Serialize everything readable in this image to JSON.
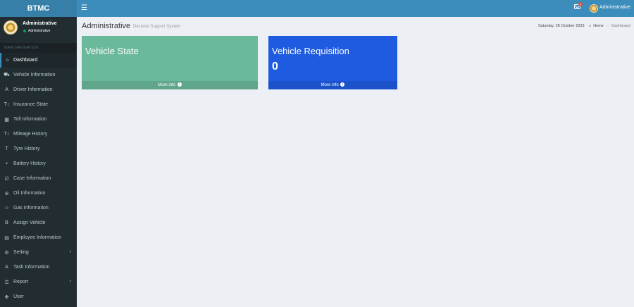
{
  "app": {
    "logo": "BTMC"
  },
  "topbar": {
    "mail_count": "0",
    "user_name": "Administrative"
  },
  "sidebar": {
    "user_name": "Administrative",
    "user_status": "Administrative",
    "nav_header": "MAIN NAVIGATION",
    "items": [
      {
        "label": "Dashboard",
        "icon": "home-icon",
        "glyph": "⌂"
      },
      {
        "label": "Vehicle Information",
        "icon": "car-icon",
        "glyph": "⛟"
      },
      {
        "label": "Driver Information",
        "icon": "driver-icon",
        "glyph": "A"
      },
      {
        "label": "Insurance State",
        "icon": "text-height-icon",
        "glyph": "T↕"
      },
      {
        "label": "Toll Information",
        "icon": "th-icon",
        "glyph": "▦"
      },
      {
        "label": "Mileage History",
        "icon": "text-height-icon",
        "glyph": "T↕"
      },
      {
        "label": "Tyre History",
        "icon": "text-width-icon",
        "glyph": "T"
      },
      {
        "label": "Battery History",
        "icon": "th-large-icon",
        "glyph": "▪"
      },
      {
        "label": "Case Information",
        "icon": "check-square-icon",
        "glyph": "☑"
      },
      {
        "label": "Oil Information",
        "icon": "life-ring-icon",
        "glyph": "⊛"
      },
      {
        "label": "Gas Information",
        "icon": "smile-icon",
        "glyph": "☺"
      },
      {
        "label": "Assign Vehicle",
        "icon": "bold-icon",
        "glyph": "B"
      },
      {
        "label": "Employee Information",
        "icon": "table-icon",
        "glyph": "▤"
      },
      {
        "label": "Setting",
        "icon": "gear-icon",
        "glyph": "⚙"
      },
      {
        "label": "Task Information",
        "icon": "font-icon",
        "glyph": "A"
      },
      {
        "label": "Report",
        "icon": "list-alt-icon",
        "glyph": "☰"
      },
      {
        "label": "User",
        "icon": "arrows-icon",
        "glyph": "✥"
      }
    ]
  },
  "header": {
    "title": "Administrative",
    "subtitle": "Decision Support System",
    "date": "Saturday, 28 October 2023",
    "breadcrumb_home": "Home",
    "breadcrumb_current": "Dashboard"
  },
  "boxes": {
    "vehicle_state": {
      "title": "Vehicle State",
      "more": "More info",
      "color": "#6bb99b"
    },
    "vehicle_requisition": {
      "title": "Vehicle Requisition",
      "count": "0",
      "more": "More info",
      "color": "#1f5be0"
    }
  }
}
